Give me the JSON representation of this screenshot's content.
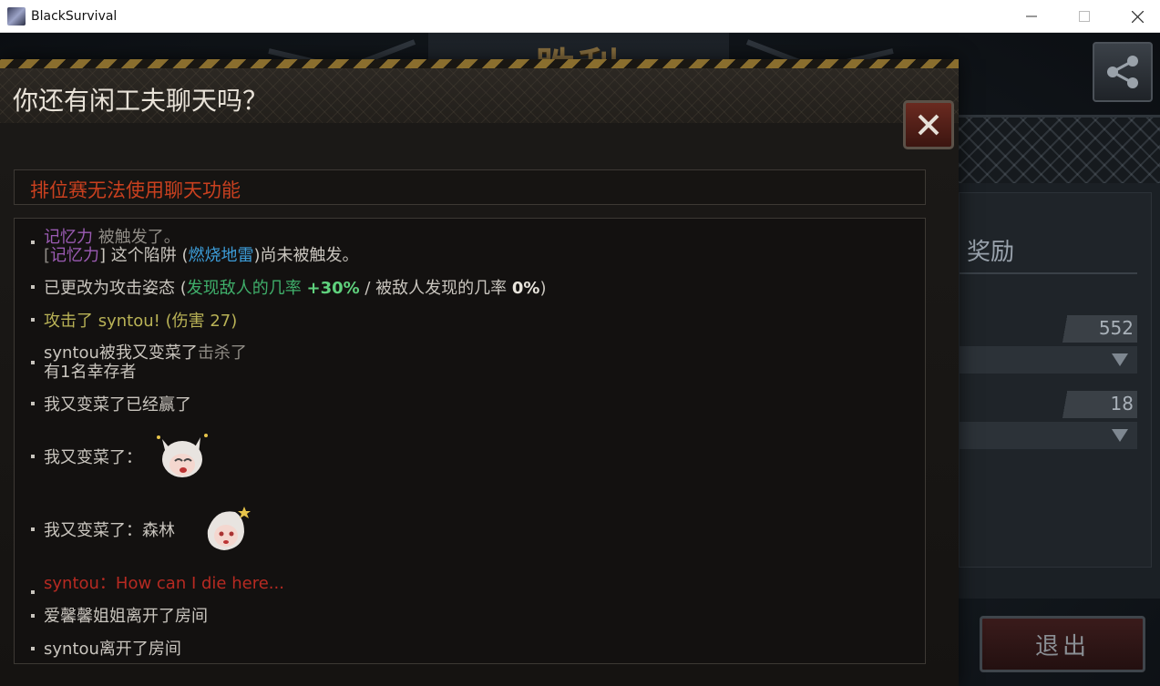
{
  "window": {
    "title": "BlackSurvival",
    "minimize_icon": "minimize-icon",
    "maximize_icon": "maximize-icon",
    "close_icon": "close-icon"
  },
  "game": {
    "victory_title": "胜利",
    "share_icon": "share-icon",
    "reward_panel": {
      "title": "奖励",
      "row1_value": "552",
      "row2_value": "18"
    },
    "exit_label": "退出"
  },
  "dialog": {
    "title": "你还有闲工夫聊天吗？",
    "close_icon": "close-x-icon",
    "notice": "排位赛无法使用聊天功能",
    "log": {
      "l1_a": "记忆力",
      "l1_b": " 被触发了。",
      "l2_a": "[",
      "l2_b": "记忆力",
      "l2_c": "] 这个陷阱 (",
      "l2_d": "燃烧地雷",
      "l2_e": ")尚未被触发。",
      "l3_a": "已更改为攻击姿态 (",
      "l3_b": "发现敌人的几率 ",
      "l3_c": "+30%",
      "l3_d": " / 被敌人发现的几率 ",
      "l3_e": "0%",
      "l3_f": ")",
      "l4": "攻击了 syntou! (伤害 27)",
      "l5_a": "syntou",
      "l5_b": "被我又变菜了",
      "l5_c": "击杀了",
      "l6": "有1名幸存者",
      "l7": "我又变菜了已经赢了",
      "l8": "我又变菜了：",
      "l9": "我又变菜了：森林",
      "l10": "syntou：How can I die here...",
      "l11": "爱馨馨姐姐离开了房间",
      "l12": "syntou离开了房间"
    }
  }
}
